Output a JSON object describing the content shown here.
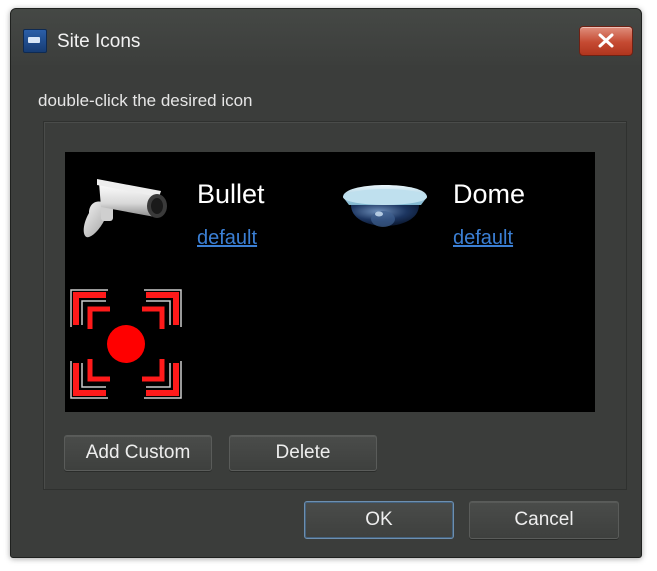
{
  "window": {
    "title": "Site Icons",
    "app_icon": "app-logo-icon",
    "close_icon": "close-icon"
  },
  "instruction": "double-click the desired icon",
  "icons": [
    {
      "name": "Bullet",
      "link": "default",
      "icon": "bullet-camera-icon"
    },
    {
      "name": "Dome",
      "link": "default",
      "icon": "dome-camera-icon"
    },
    {
      "name": "",
      "link": "",
      "icon": "target-marker-icon"
    }
  ],
  "buttons": {
    "add_custom": "Add Custom",
    "delete": "Delete",
    "ok": "OK",
    "cancel": "Cancel"
  },
  "colors": {
    "window_bg": "#3b3d3b",
    "panel_bg": "#000000",
    "link": "#3b7fd4",
    "close_button": "#c54a32",
    "target_red": "#ff1a1a"
  }
}
